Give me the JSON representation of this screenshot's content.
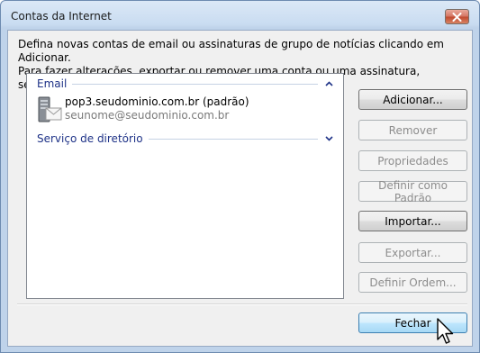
{
  "window": {
    "title": "Contas da Internet"
  },
  "instructions": {
    "line1": "Defina novas contas de email ou assinaturas de grupo de notícias clicando em Adicionar.",
    "line2": "Para fazer alterações, exportar ou remover uma conta ou uma assinatura, selecione-a primeiro."
  },
  "list": {
    "groups": [
      {
        "label": "Email",
        "state": "expanded",
        "icon": "chevron-up-icon"
      },
      {
        "label": "Serviço de diretório",
        "state": "collapsed",
        "icon": "chevron-down-icon"
      }
    ],
    "accounts": [
      {
        "name": "pop3.seudominio.com.br (padrão)",
        "email": "seunome@seudominio.com.br",
        "icon": "mail-server-icon"
      }
    ]
  },
  "buttons": {
    "add": "Adicionar...",
    "remove": "Remover",
    "properties": "Propriedades",
    "set_default": "Definir como Padrão",
    "import": "Importar...",
    "export": "Exportar...",
    "set_order": "Definir Ordem...",
    "close": "Fechar"
  },
  "colors": {
    "group_header": "#1e3287",
    "default_button": "#bee6fd"
  }
}
